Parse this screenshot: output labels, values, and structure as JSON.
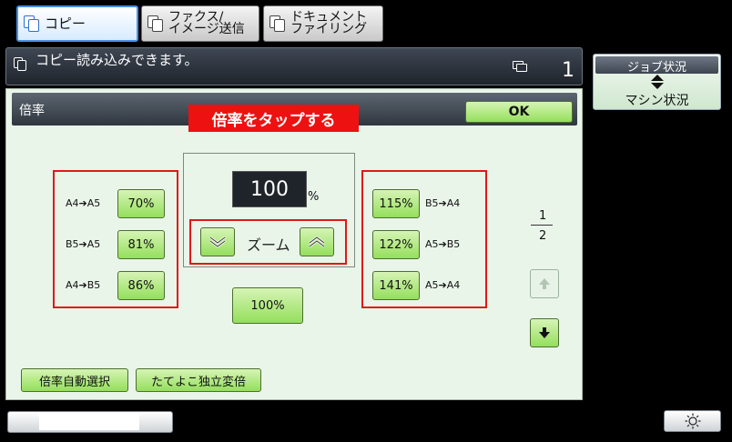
{
  "tabs": [
    {
      "label": "コピー",
      "active": true
    },
    {
      "label": "ファクス/\nイメージ送信",
      "active": false
    },
    {
      "label": "ドキュメント\nファイリング",
      "active": false
    }
  ],
  "status": {
    "message": "コピー読み込みできます。",
    "count": "1"
  },
  "job_status": {
    "top": "ジョブ状況",
    "bottom": "マシン状況"
  },
  "panel": {
    "title": "倍率",
    "hint": "倍率をタップする",
    "ok": "OK",
    "ratio_value": "100",
    "percent_sign": "%",
    "zoom_label": "ズーム",
    "reset_label": "100%",
    "reduce_presets": [
      {
        "conversion": "A4➔A5",
        "label": "70%"
      },
      {
        "conversion": "B5➔A5",
        "label": "81%"
      },
      {
        "conversion": "A4➔B5",
        "label": "86%"
      }
    ],
    "enlarge_presets": [
      {
        "conversion": "B5➔A4",
        "label": "115%"
      },
      {
        "conversion": "A5➔B5",
        "label": "122%"
      },
      {
        "conversion": "A5➔A4",
        "label": "141%"
      }
    ],
    "page": {
      "current": "1",
      "total": "2"
    },
    "auto_select": "倍率自動選択",
    "xy_zoom": "たてよこ独立変倍"
  },
  "colors": {
    "accent_green": "#94df5c",
    "hint_red": "#e01818",
    "active_tab": "#4b90e8"
  }
}
